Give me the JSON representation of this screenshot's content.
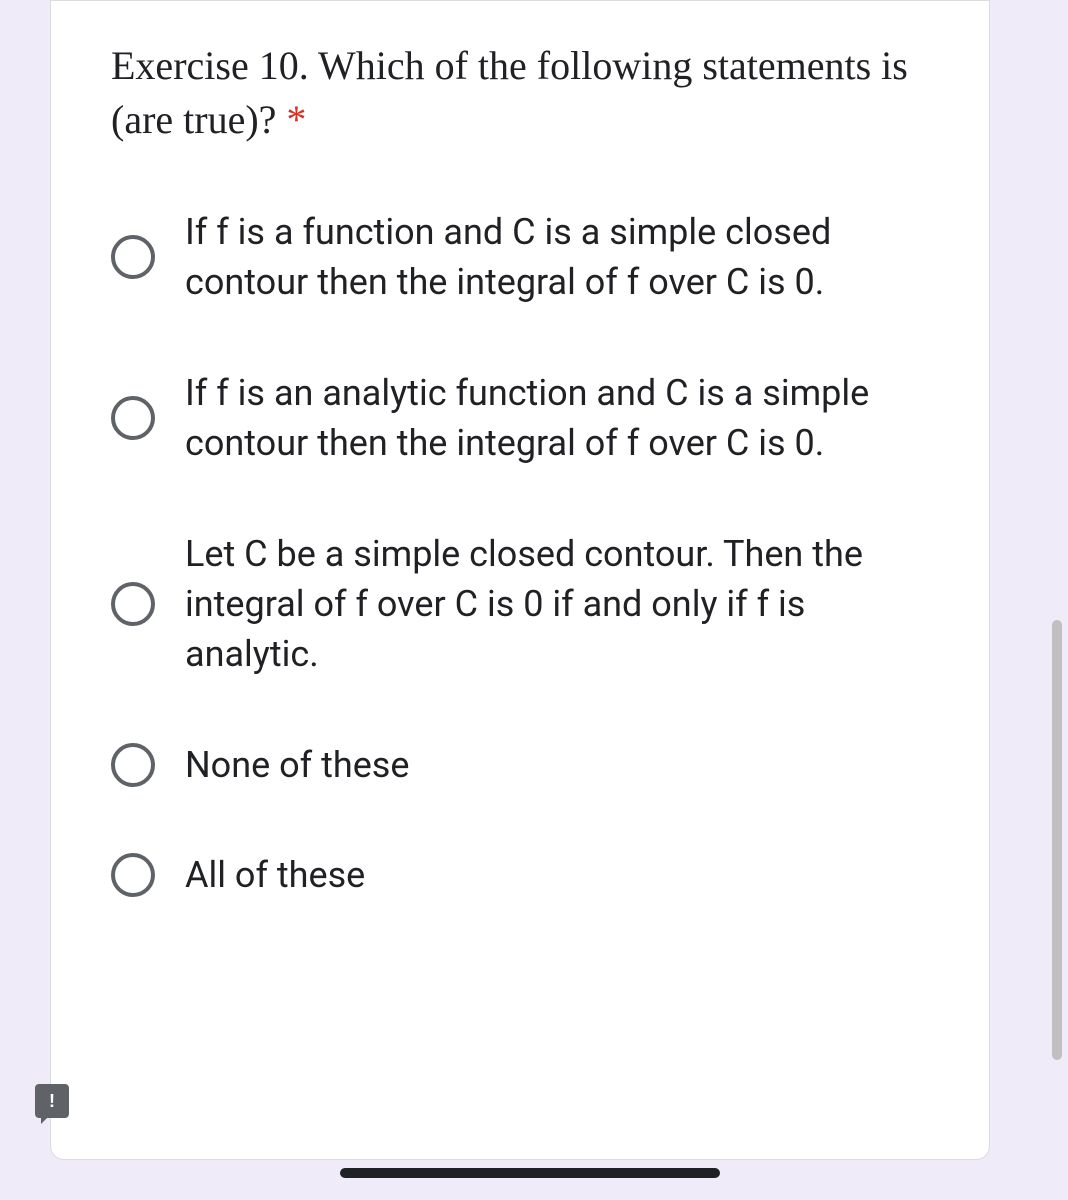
{
  "question": {
    "title": "Exercise 10. Which of the following statements is (are true)? ",
    "required_mark": "*",
    "options": [
      "If f is a function and C is a simple closed contour then the integral of f over C is 0.",
      "If f is an analytic function and C is a simple contour then the integral of f over C is 0.",
      "Let C be a simple closed contour. Then the integral of f over C is 0 if and only if f is analytic.",
      "None of these",
      "All of these"
    ]
  },
  "feedback_icon_text": "!"
}
